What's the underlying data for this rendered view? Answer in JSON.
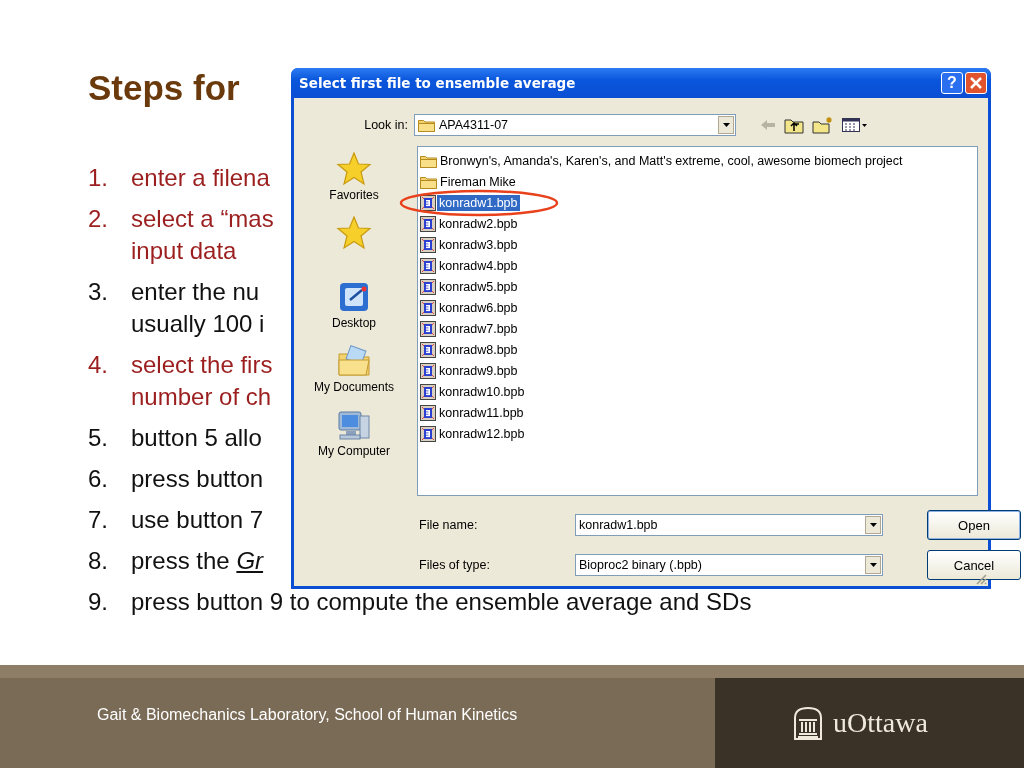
{
  "slide": {
    "title": "Steps for",
    "steps": [
      {
        "number": "1.",
        "lines": [
          "enter a filena"
        ],
        "color": "#9c1f1f"
      },
      {
        "number": "2.",
        "lines": [
          "select a “mas",
          "input data"
        ],
        "color": "#9c1f1f"
      },
      {
        "number": "3.",
        "lines": [
          "enter the nu",
          "usually 100 i"
        ],
        "color": "#111111"
      },
      {
        "number": "4.",
        "lines": [
          "select the firs",
          "number of ch"
        ],
        "color": "#9c1f1f"
      },
      {
        "number": "5.",
        "lines": [
          "button 5 allo"
        ],
        "color": "#111111"
      },
      {
        "number": "6.",
        "lines": [
          "press button"
        ],
        "color": "#111111"
      },
      {
        "number": "7.",
        "lines": [
          "use button 7"
        ],
        "color": "#111111"
      },
      {
        "number": "8.",
        "lines": [
          "press the *Gr*"
        ],
        "color": "#111111"
      },
      {
        "number": "9.",
        "lines": [
          "press button 9 to compute the ensemble average and SDs"
        ],
        "color": "#111111"
      }
    ]
  },
  "dialog": {
    "title": "Select first file to ensemble average",
    "help": "?",
    "look_in": {
      "label": "Look in:",
      "value": "APA4311-07"
    },
    "places": [
      {
        "kind": "star",
        "label": "Favorites"
      },
      {
        "kind": "star"
      },
      {
        "kind": "desktop",
        "label": "Desktop"
      },
      {
        "kind": "documents",
        "label": "My Documents"
      },
      {
        "kind": "computer",
        "label": "My Computer"
      }
    ],
    "files": [
      {
        "kind": "folder",
        "name": "Bronwyn's, Amanda's, Karen's, and Matt's extreme, cool, awesome biomech project",
        "selected": false
      },
      {
        "kind": "folder",
        "name": "Fireman Mike",
        "selected": false
      },
      {
        "kind": "file",
        "name": "konradw1.bpb",
        "selected": true
      },
      {
        "kind": "file",
        "name": "konradw2.bpb",
        "selected": false
      },
      {
        "kind": "file",
        "name": "konradw3.bpb",
        "selected": false
      },
      {
        "kind": "file",
        "name": "konradw4.bpb",
        "selected": false
      },
      {
        "kind": "file",
        "name": "konradw5.bpb",
        "selected": false
      },
      {
        "kind": "file",
        "name": "konradw6.bpb",
        "selected": false
      },
      {
        "kind": "file",
        "name": "konradw7.bpb",
        "selected": false
      },
      {
        "kind": "file",
        "name": "konradw8.bpb",
        "selected": false
      },
      {
        "kind": "file",
        "name": "konradw9.bpb",
        "selected": false
      },
      {
        "kind": "file",
        "name": "konradw10.bpb",
        "selected": false
      },
      {
        "kind": "file",
        "name": "konradw11.bpb",
        "selected": false
      },
      {
        "kind": "file",
        "name": "konradw12.bpb",
        "selected": false
      }
    ],
    "file_name": {
      "label": "File name:",
      "value": "konradw1.bpb"
    },
    "file_type": {
      "label": "Files of type:",
      "value": "Bioproc2 binary (.bpb)"
    },
    "buttons": [
      "Open",
      "Cancel"
    ]
  },
  "footer": {
    "text": "Gait & Biomechanics Laboratory, School of Human Kinetics",
    "logo": "uOttawa"
  }
}
